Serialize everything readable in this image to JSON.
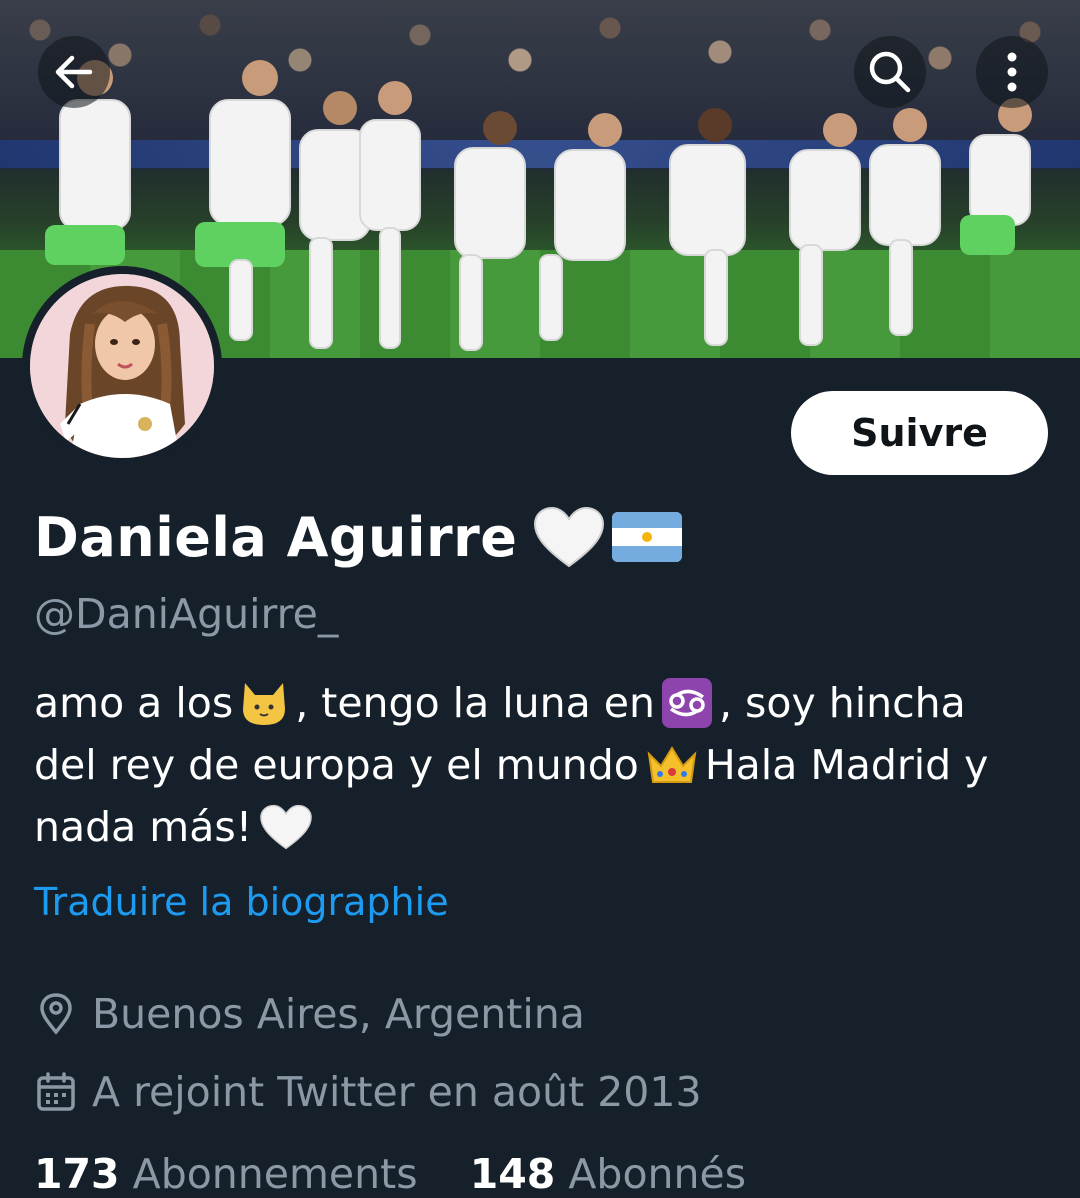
{
  "header": {
    "icons": [
      "back-arrow-icon",
      "search-icon",
      "more-vertical-icon"
    ]
  },
  "profile": {
    "display_name": "Daniela Aguirre",
    "name_emojis": [
      "white-heart-emoji",
      "argentina-flag-emoji"
    ],
    "handle": "@DaniAguirre_",
    "follow_label": "Suivre",
    "bio": {
      "line1_a": "amo a los",
      "line1_b": ", tengo la luna en",
      "line1_c": ", soy hincha",
      "line2_a": "del rey de europa y el mundo",
      "line2_b": "Hala Madrid y",
      "line3_a": "nada más!",
      "emojis": [
        "cat-emoji",
        "cancer-sign-emoji",
        "crown-emoji",
        "white-heart-emoji"
      ]
    },
    "translate_label": "Traduire la biographie",
    "location": "Buenos Aires, Argentina",
    "joined": "A rejoint Twitter en août 2013",
    "counts_partial": {
      "following_value": "173",
      "following_label": "Abonnements",
      "followers_value": "148",
      "followers_label": "Abonnés"
    }
  },
  "colors": {
    "background": "#15202b",
    "muted_text": "#8b98a5",
    "link": "#1d9bf0",
    "button_bg": "#ffffff",
    "button_text": "#0f1419"
  }
}
